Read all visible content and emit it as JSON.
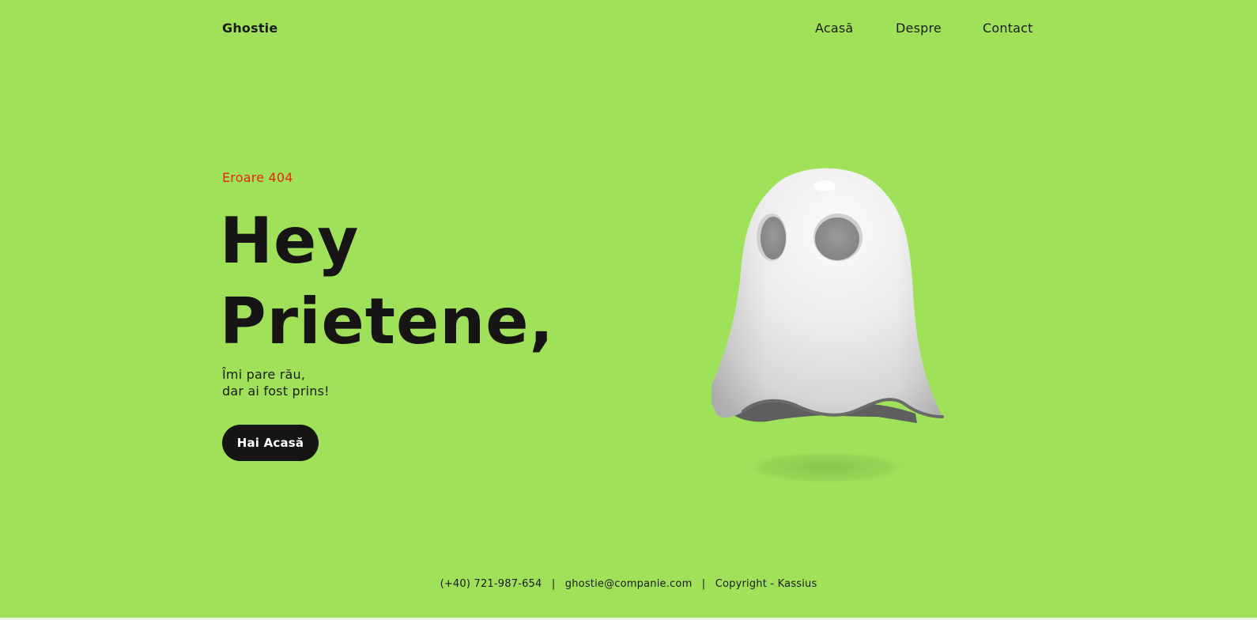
{
  "brand": {
    "name": "Ghostie"
  },
  "nav": {
    "items": [
      {
        "label": "Acasă"
      },
      {
        "label": "Despre"
      },
      {
        "label": "Contact"
      }
    ]
  },
  "hero": {
    "eyebrow": "Eroare 404",
    "headline_line1": "Hey",
    "headline_line2": "Prietene,",
    "subtitle_line1": "Îmi pare rău,",
    "subtitle_line2": "dar ai fost prins!",
    "cta_label": "Hai Acasă",
    "illustration_icon": "ghost-icon"
  },
  "footer": {
    "phone": "(+40) 721-987-654",
    "email": "ghostie@companie.com",
    "copyright": "Copyright - Kassius",
    "separator": "|"
  },
  "colors": {
    "background": "#9fe25a",
    "accent_error": "#e8260e",
    "text_dark": "#161414",
    "button_bg": "#171414",
    "button_text": "#ffffff"
  }
}
